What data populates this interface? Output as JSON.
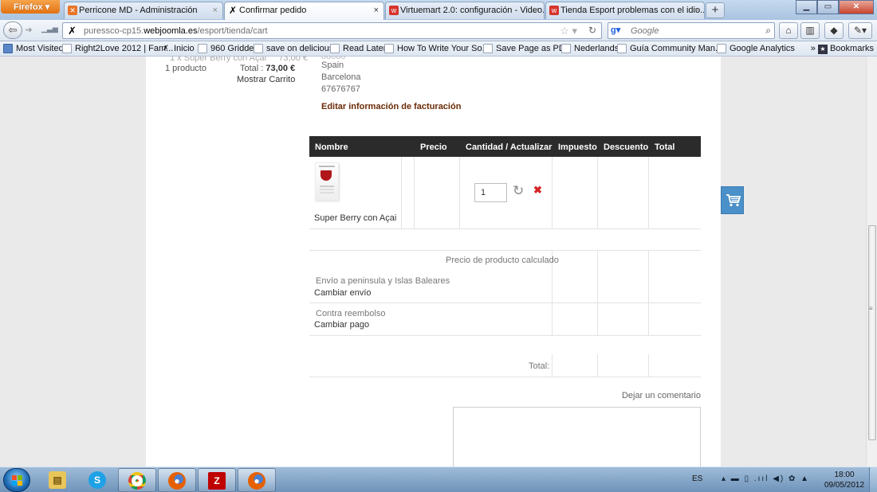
{
  "browser": {
    "menu_button": "Firefox",
    "tabs": [
      {
        "title": "Perricone MD - Administración",
        "favicon": "joomla-icon"
      },
      {
        "title": "Confirmar pedido",
        "favicon": "site-icon"
      },
      {
        "title": "Virtuemart 2.0: configuración - Video...",
        "favicon": "w-icon"
      },
      {
        "title": "Tienda Esport problemas con el idio...",
        "favicon": "w-icon"
      }
    ],
    "new_tab": "+",
    "url_prefix": "puressco-cp15.",
    "url_domain": "webjoomla.es",
    "url_path": "/esport/tienda/cart",
    "search_placeholder": "Google"
  },
  "bookmarks": [
    "Most Visited",
    "Right2Love 2012 | Fam...",
    "Inicio",
    "960 Gridder",
    "save on delicious",
    "Read Later",
    "How To Write Your So...",
    "Save Page as PDF",
    "Nederlands",
    "Guía Community Man...",
    "Google Analytics"
  ],
  "bookmarks_more": "Bookmarks",
  "mini_cart": {
    "item_count": "1 producto",
    "total_label": "Total :",
    "total_value": "73,00 €",
    "show_cart": "Mostrar Carrito"
  },
  "address": {
    "country": "Spain",
    "city": "Barcelona",
    "phone": "67676767",
    "edit_billing": "Editar información de facturación"
  },
  "table": {
    "headers": {
      "name": "Nombre",
      "price": "Precio",
      "qty": "Cantidad / Actualizar",
      "tax": "Impuesto",
      "discount": "Descuento",
      "total": "Total"
    },
    "product": {
      "name": "Super Berry con Açai",
      "quantity": "1"
    },
    "calculated_price_label": "Precio de producto calculado",
    "shipping_label": "Envío a peninsula y Islas Baleares",
    "change_shipping": "Cambiar envío",
    "payment_label": "Contra reembolso",
    "change_payment": "Cambiar pago",
    "total_label": "Total:"
  },
  "comment_label": "Dejar un comentario",
  "taskbar": {
    "lang": "ES",
    "time": "18:00",
    "date": "09/05/2012"
  },
  "colors": {
    "table_header": "#2b2b2b",
    "billing_link": "#6b2a05",
    "delete_icon": "#d42323",
    "cart_button": "#4a90c9"
  }
}
